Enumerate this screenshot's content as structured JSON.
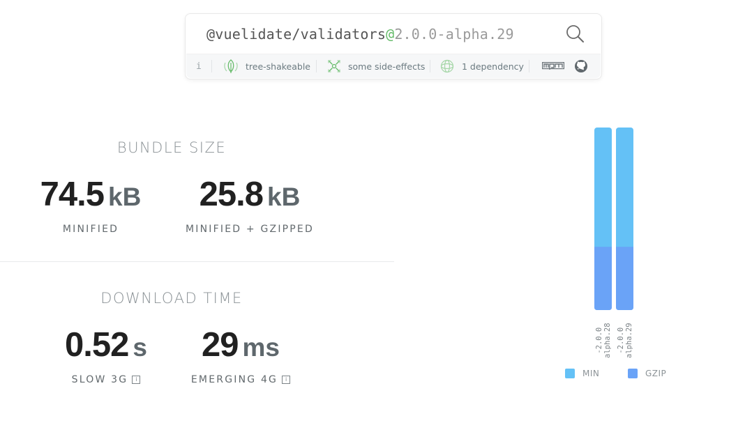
{
  "search": {
    "package_name": "@vuelidate/validators",
    "at_symbol": "@",
    "version": "2.0.0-alpha.29"
  },
  "info_bar": {
    "info": "i",
    "tree_shakeable": "tree-shakeable",
    "side_effects": "some side-effects",
    "dependencies": "1 dependency"
  },
  "bundle_size": {
    "title": "BUNDLE SIZE",
    "minified_value": "74.5",
    "minified_unit": "kB",
    "minified_label": "MINIFIED",
    "gzipped_value": "25.8",
    "gzipped_unit": "kB",
    "gzipped_label": "MINIFIED + GZIPPED"
  },
  "download_time": {
    "title": "DOWNLOAD TIME",
    "slow_value": "0.52",
    "slow_unit": "s",
    "slow_label": "SLOW 3G",
    "emerging_value": "29",
    "emerging_unit": "ms",
    "emerging_label": "EMERGING 4G",
    "info_glyph": "i"
  },
  "colors": {
    "min": "#64c1f6",
    "gzip": "#6aa3f7",
    "accent_green": "#66bb6a"
  },
  "chart_data": {
    "type": "bar",
    "stacked": true,
    "categories": [
      "2.0.0-alpha.28",
      "2.0.0-alpha.29"
    ],
    "series": [
      {
        "name": "GZIP",
        "values": [
          25.8,
          25.8
        ]
      },
      {
        "name": "MIN",
        "values": [
          74.5,
          74.5
        ]
      }
    ],
    "legend": [
      "MIN",
      "GZIP"
    ],
    "legend_position": "bottom"
  }
}
